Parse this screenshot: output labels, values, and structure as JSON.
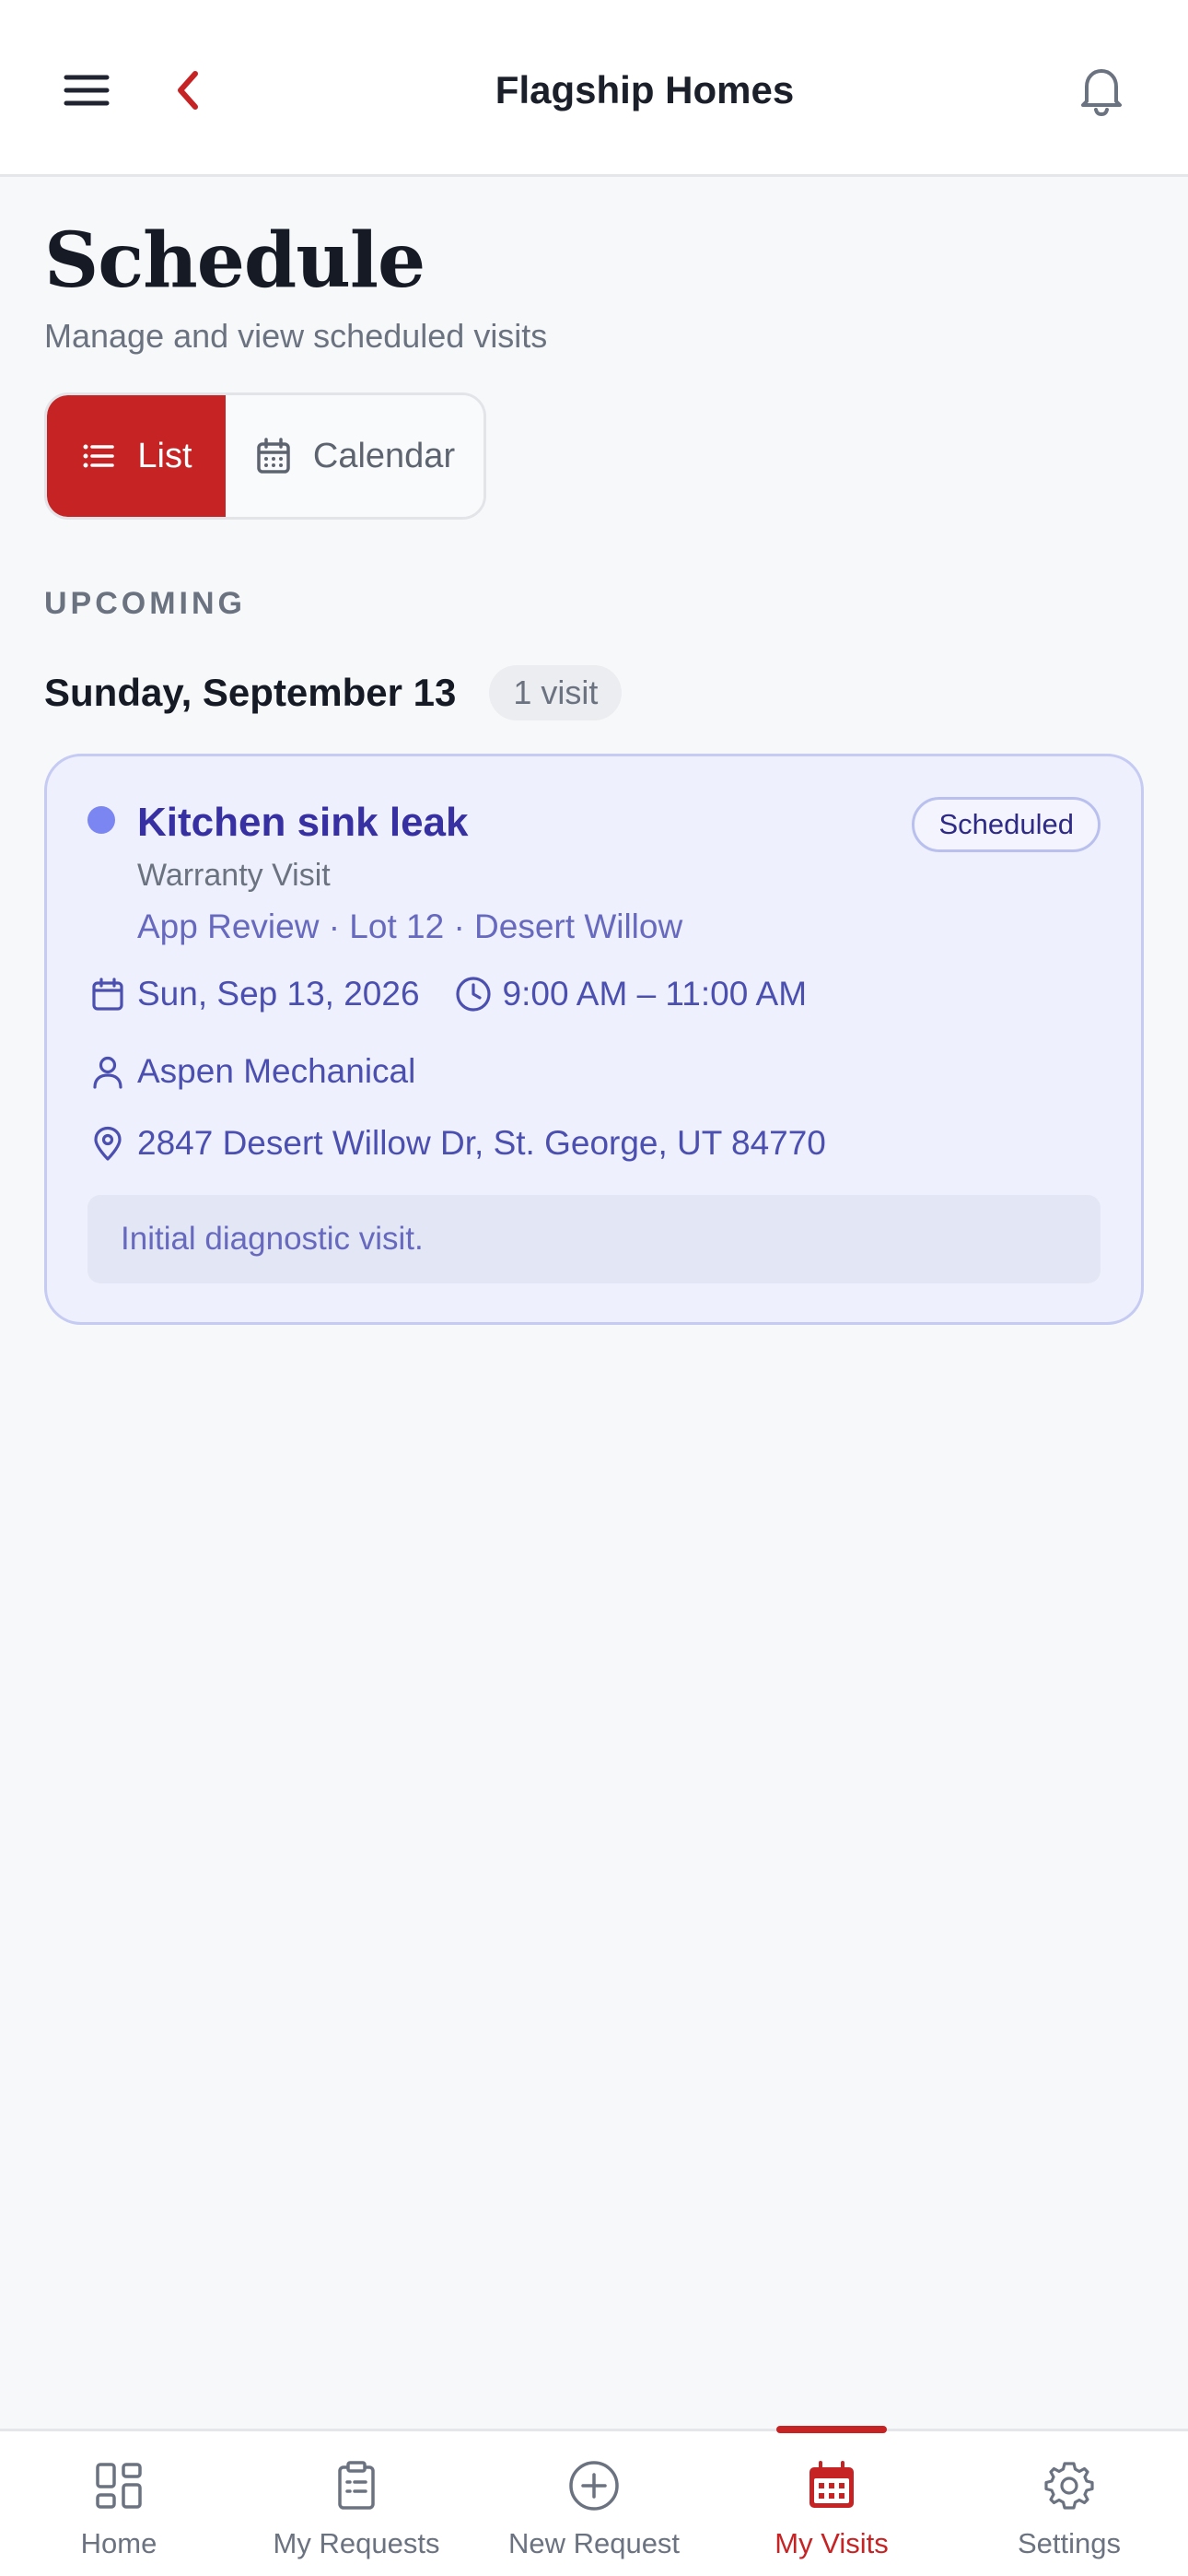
{
  "header": {
    "title": "Flagship Homes"
  },
  "page": {
    "title": "Schedule",
    "subtitle": "Manage and view scheduled visits"
  },
  "view_toggle": {
    "list_label": "List",
    "calendar_label": "Calendar",
    "selected": "List"
  },
  "section": {
    "label": "UPCOMING"
  },
  "day_group": {
    "date": "Sunday, September 13",
    "count": "1 visit"
  },
  "visit": {
    "title": "Kitchen sink leak",
    "status": "Scheduled",
    "type": "Warranty Visit",
    "meta": "App Review · Lot 12 · Desert Willow",
    "date": "Sun, Sep 13, 2026",
    "time": "9:00 AM – 11:00 AM",
    "technician": "Aspen Mechanical",
    "address": "2847 Desert Willow Dr, St. George, UT 84770",
    "note": "Initial diagnostic visit."
  },
  "bottom_nav": {
    "items": [
      {
        "label": "Home",
        "icon": "grid-icon"
      },
      {
        "label": "My Requests",
        "icon": "clipboard-icon"
      },
      {
        "label": "New Request",
        "icon": "plus-circle-icon"
      },
      {
        "label": "My Visits",
        "icon": "calendar-icon"
      },
      {
        "label": "Settings",
        "icon": "gear-icon"
      }
    ],
    "active": "My Visits"
  },
  "colors": {
    "accent": "#c62325",
    "visit_card_bg": "#eef0fd",
    "visit_text": "#3730a3"
  }
}
